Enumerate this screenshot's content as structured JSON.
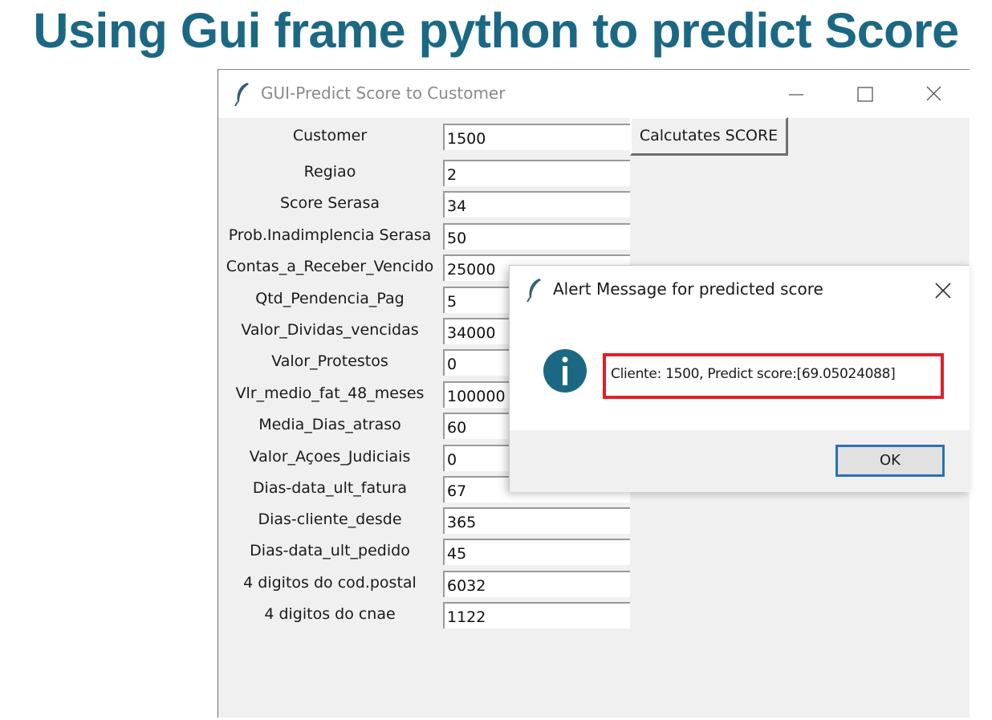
{
  "slide": {
    "title": "Using Gui frame python to predict Score"
  },
  "main_window": {
    "title": "GUI-Predict Score to Customer",
    "calc_button_label": "Calcutates SCORE",
    "fields": [
      {
        "label": "Customer",
        "value": "1500"
      },
      {
        "label": "Regiao",
        "value": "2"
      },
      {
        "label": "Score Serasa",
        "value": "34"
      },
      {
        "label": "Prob.Inadimplencia Serasa",
        "value": "50"
      },
      {
        "label": "Contas_a_Receber_Vencido",
        "value": "25000"
      },
      {
        "label": "Qtd_Pendencia_Pag",
        "value": "5"
      },
      {
        "label": "Valor_Dividas_vencidas",
        "value": "34000"
      },
      {
        "label": "Valor_Protestos",
        "value": "0"
      },
      {
        "label": "Vlr_medio_fat_48_meses",
        "value": "100000"
      },
      {
        "label": "Media_Dias_atraso",
        "value": "60"
      },
      {
        "label": "Valor_Açoes_Judiciais",
        "value": "0"
      },
      {
        "label": "Dias-data_ult_fatura",
        "value": "67"
      },
      {
        "label": "Dias-cliente_desde",
        "value": "365"
      },
      {
        "label": "Dias-data_ult_pedido",
        "value": "45"
      },
      {
        "label": "4 digitos do cod.postal",
        "value": "6032"
      },
      {
        "label": "4 digitos do cnae",
        "value": "1122"
      }
    ]
  },
  "dialog": {
    "title": "Alert Message for predicted score",
    "message": "Cliente: 1500, Predict score:[69.05024088]",
    "ok_label": "OK"
  },
  "colors": {
    "title_text": "#1b6884",
    "info_icon": "#1b6884",
    "highlight_border": "#e02127",
    "ok_focus_border": "#2a72b5"
  },
  "icons": [
    "feather-icon",
    "minimize-icon",
    "maximize-icon",
    "close-icon",
    "info-icon"
  ]
}
